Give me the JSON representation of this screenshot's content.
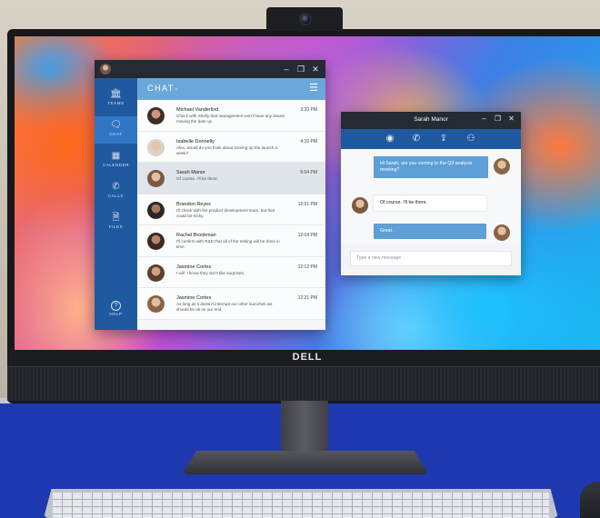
{
  "brand": "DELL",
  "chat_app": {
    "rail": [
      {
        "icon": "teams-icon",
        "glyph": "🏛",
        "label": "TEAMS",
        "active": false
      },
      {
        "icon": "chat-icon",
        "glyph": "🗨",
        "label": "CHAT",
        "active": true
      },
      {
        "icon": "calendar-icon",
        "glyph": "▦",
        "label": "CALENDER",
        "active": false
      },
      {
        "icon": "phone-icon",
        "glyph": "✆",
        "label": "CALLS",
        "active": false
      },
      {
        "icon": "files-icon",
        "glyph": "🗎",
        "label": "FILES",
        "active": false
      }
    ],
    "help": {
      "icon": "help-icon",
      "glyph": "?",
      "label": "HELP"
    },
    "header": {
      "title": "CHAT",
      "chevron": "⌄",
      "menu": "☰"
    },
    "window_controls": [
      "–",
      "❐",
      "✕"
    ],
    "conversations": [
      {
        "name": "Michael Vanderlind",
        "time": "3:20 PM",
        "preview": "Check with Shelly that management won't have any issues moving the date up",
        "selected": false,
        "avatar": "av1"
      },
      {
        "name": "Isabelle Donnelly",
        "time": "4:10 PM",
        "preview": "Alex, would do you think about moving up the launch a week?",
        "selected": false,
        "avatar": "av2"
      },
      {
        "name": "Sarah Manor",
        "time": "6:04 PM",
        "preview": "Of course. I'll be there.",
        "selected": true,
        "avatar": "av3"
      },
      {
        "name": "Brandon Reyes",
        "time": "12:01 PM",
        "preview": "I'll check with the product development team, but that could be tricky.",
        "selected": false,
        "avatar": "av4"
      },
      {
        "name": "Rachel Brookman",
        "time": "12:04 PM",
        "preview": "I'll confirm with R&D that all of the testing will be done in time.",
        "selected": false,
        "avatar": "av5"
      },
      {
        "name": "Jasmine Cortes",
        "time": "12:12 PM",
        "preview": "I will. I know they don't like surprises.",
        "selected": false,
        "avatar": "av6"
      },
      {
        "name": "Jasmine Cortes",
        "time": "12:21 PM",
        "preview": "As long as it doesn't interrupt our other launches we should be ok on our end.",
        "selected": false,
        "avatar": "av7"
      }
    ]
  },
  "conversation_window": {
    "title": "Sarah Manor",
    "controls": [
      "–",
      "❐",
      "✕"
    ],
    "tools": [
      {
        "icon": "webcam-icon",
        "glyph": "◉"
      },
      {
        "icon": "phone-icon",
        "glyph": "✆"
      },
      {
        "icon": "screen-share-icon",
        "glyph": "⇪"
      },
      {
        "icon": "add-person-icon",
        "glyph": "⚇"
      }
    ],
    "messages": [
      {
        "from": "me",
        "text": "Hi Sarah, are you coming to the Q3 analysis meeting?"
      },
      {
        "from": "them",
        "text": "Of course. I'll be there."
      },
      {
        "from": "me",
        "text": "Great."
      }
    ],
    "composer_placeholder": "Type a new message"
  }
}
